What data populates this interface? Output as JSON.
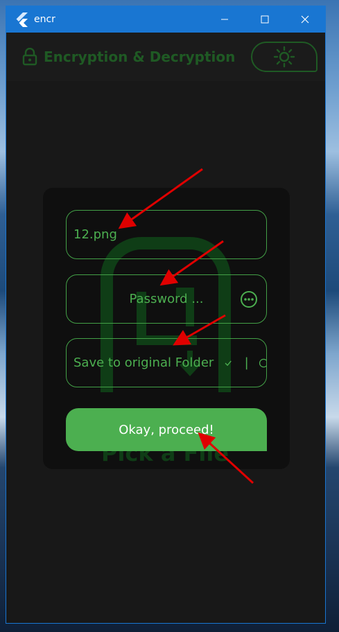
{
  "window": {
    "title": "encr",
    "controls": [
      "minimize-icon",
      "maximize-icon",
      "close-icon"
    ]
  },
  "appbar": {
    "title": "Encryption & Decryption",
    "lock_icon": "lock-icon",
    "theme_icon": "sun-icon"
  },
  "card": {
    "background_label": "Pick a File",
    "filename_value": "12.png",
    "password_placeholder": "Password ...",
    "save_option": "Save to original Folder",
    "separator": "|",
    "proceed_label": "Okay, proceed!"
  },
  "colors": {
    "titlebar": "#1976d2",
    "accent_green": "#4caf50",
    "dark_green": "#1f5a24",
    "window_bg": "#181818",
    "card_bg": "#0f0f0f",
    "annotation_red": "#e00000"
  }
}
